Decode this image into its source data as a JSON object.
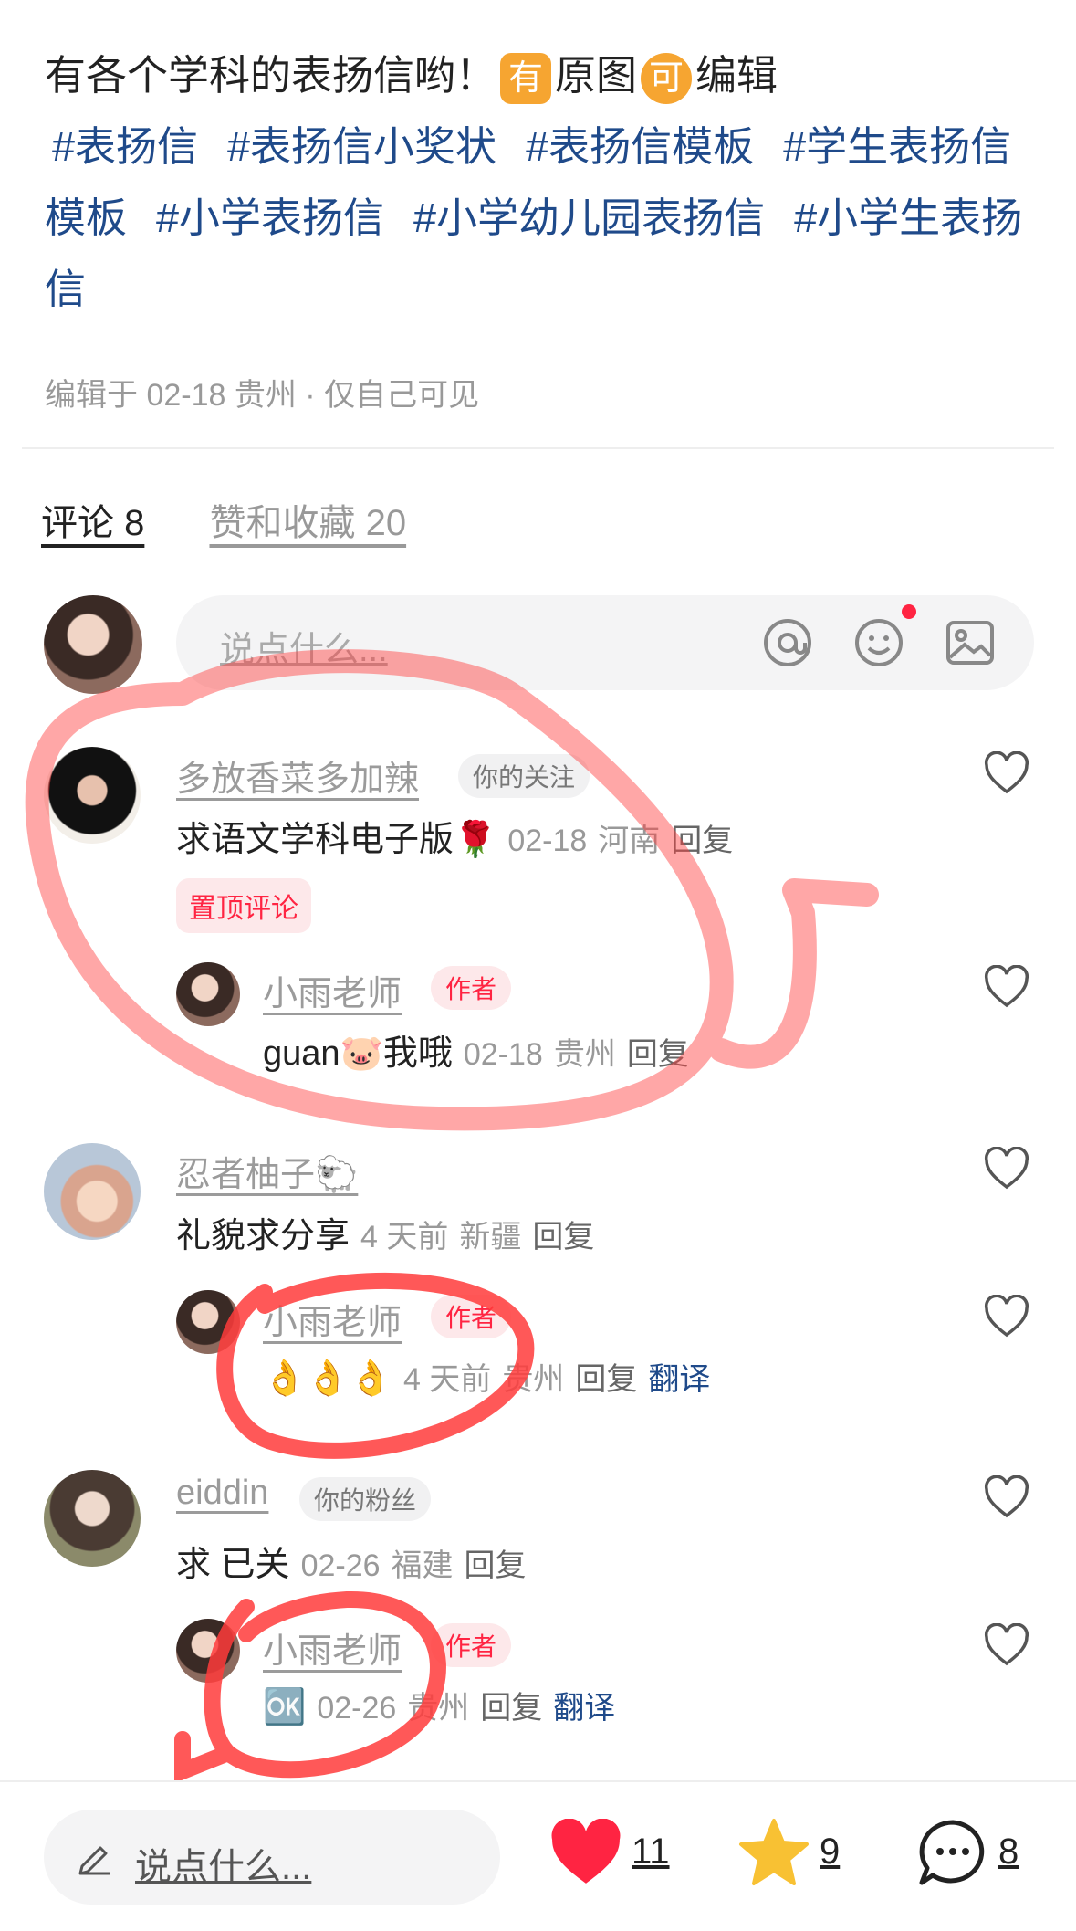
{
  "post": {
    "line1_text": "有各个学科的表扬信哟！",
    "badge_you": "有",
    "text_yuantu": "原图",
    "badge_ke": "可",
    "text_bianji": "编辑",
    "tags": [
      "#表扬信",
      "#表扬信小奖状",
      "#表扬信模板",
      "#学生表扬信模板",
      "#小学表扬信",
      "#小学幼儿园表扬信",
      "#小学生表扬信"
    ],
    "edit_meta": "编辑于 02-18 贵州 · 仅自己可见"
  },
  "tabs": {
    "comments": "评论 8",
    "likes_collects": "赞和收藏 20"
  },
  "comment_input": {
    "placeholder": "说点什么..."
  },
  "comments": [
    {
      "name": "多放香菜多加辣",
      "tag": "你的关注",
      "text": "求语文学科电子版🌹",
      "time": "02-18",
      "location": "河南",
      "reply": "回复",
      "pinned": "置顶评论",
      "sub": {
        "name": "小雨老师",
        "tag": "作者",
        "text": "guan🐷我哦",
        "time": "02-18",
        "location": "贵州",
        "reply": "回复"
      }
    },
    {
      "name": "忍者柚子🐑",
      "text": "礼貌求分享",
      "time": "4 天前",
      "location": "新疆",
      "reply": "回复",
      "sub": {
        "name": "小雨老师",
        "tag": "作者",
        "text": "👌👌👌",
        "time": "4 天前",
        "location": "贵州",
        "reply": "回复",
        "translate": "翻译"
      }
    },
    {
      "name": "eiddin",
      "tag": "你的粉丝",
      "text": "求 已关",
      "time": "02-26",
      "location": "福建",
      "reply": "回复",
      "sub": {
        "name": "小雨老师",
        "tag": "作者",
        "text": "🆗",
        "time": "02-26",
        "location": "贵州",
        "reply": "回复",
        "translate": "翻译"
      }
    }
  ],
  "bottom": {
    "placeholder": "说点什么...",
    "likes": "11",
    "stars": "9",
    "comments": "8"
  },
  "colors": {
    "accent_red": "#ff2442",
    "tag_blue": "#1f4a8a",
    "star_yellow": "#f8c133",
    "annotation_red": "#ff3b3b"
  }
}
